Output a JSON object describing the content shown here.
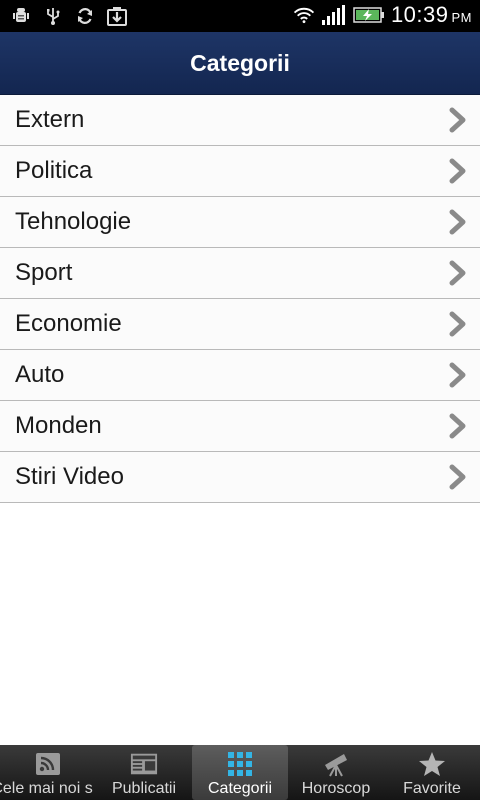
{
  "status_bar": {
    "time": "10:39",
    "ampm": "PM",
    "left_icons": [
      "android-debug-icon",
      "usb-icon",
      "sync-icon",
      "download-icon"
    ],
    "right_icons": [
      "wifi-icon",
      "signal-icon",
      "battery-charging-icon"
    ]
  },
  "header": {
    "title": "Categorii",
    "color": "#1b3060"
  },
  "categories": [
    {
      "label": "Extern"
    },
    {
      "label": "Politica"
    },
    {
      "label": "Tehnologie"
    },
    {
      "label": "Sport"
    },
    {
      "label": "Economie"
    },
    {
      "label": "Auto"
    },
    {
      "label": "Monden"
    },
    {
      "label": "Stiri Video"
    }
  ],
  "tabs": [
    {
      "label": "Cele mai noi s",
      "icon": "rss-icon"
    },
    {
      "label": "Publicatii",
      "icon": "newspaper-icon"
    },
    {
      "label": "Categorii",
      "icon": "grid-icon",
      "active": true,
      "accent": "#33b5e5"
    },
    {
      "label": "Horoscop",
      "icon": "telescope-icon"
    },
    {
      "label": "Favorite",
      "icon": "star-icon"
    }
  ]
}
